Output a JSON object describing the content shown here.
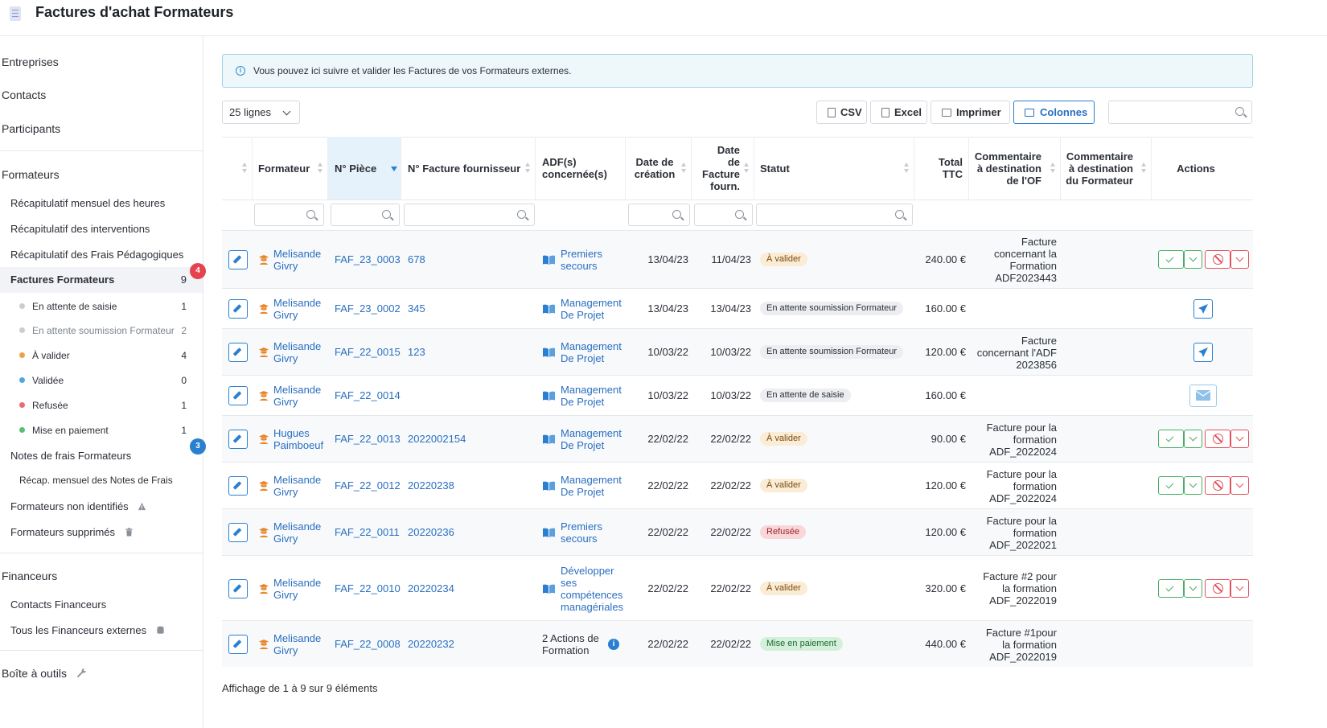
{
  "header": {
    "title": "Factures d'achat Formateurs"
  },
  "sidebar": {
    "top_items": [
      "Entreprises",
      "Contacts",
      "Participants"
    ],
    "formateurs": {
      "title": "Formateurs",
      "items": [
        "Récapitulatif mensuel des heures",
        "Récapitulatif des interventions",
        "Récapitulatif des Frais Pédagogiques"
      ],
      "active": {
        "label": "Factures Formateurs",
        "count": "9",
        "badge": "4"
      },
      "statuses": [
        {
          "label": "En attente de saisie",
          "count": "1",
          "color": "#c9cdd3"
        },
        {
          "label": "En attente soumission Formateur",
          "count": "2",
          "color": "#c9cdd3"
        },
        {
          "label": "À valider",
          "count": "4",
          "color": "#f0a04b"
        },
        {
          "label": "Validée",
          "count": "0",
          "color": "#4ea8de"
        },
        {
          "label": "Refusée",
          "count": "1",
          "color": "#ec6b73"
        },
        {
          "label": "Mise en paiement",
          "count": "1",
          "color": "#55c273"
        }
      ],
      "notes": {
        "label": "Notes de frais Formateurs",
        "badge": "3"
      },
      "recap_notes": "Récap. mensuel des Notes de Frais",
      "non_identifies": "Formateurs non identifiés",
      "supprimes": "Formateurs supprimés"
    },
    "financeurs": {
      "title": "Financeurs",
      "items": [
        "Contacts Financeurs",
        "Tous les Financeurs externes"
      ]
    },
    "outils": "Boîte à outils"
  },
  "info_banner": "Vous pouvez ici suivre et valider les Factures de vos Formateurs externes.",
  "toolbar": {
    "lines": "25 lignes",
    "csv": "CSV",
    "excel": "Excel",
    "print": "Imprimer",
    "columns": "Colonnes",
    "search_placeholder": ""
  },
  "table": {
    "headers": {
      "formateur": "Formateur",
      "piece": "N° Pièce",
      "facture": "N° Facture fournisseur",
      "adf": [
        "ADF(s)",
        "concernée(s)"
      ],
      "creation": [
        "Date de",
        "création"
      ],
      "date_facture": [
        "Date",
        "de",
        "Facture",
        "fourn."
      ],
      "statut": "Statut",
      "total": [
        "Total",
        "TTC"
      ],
      "comment_of": [
        "Commentaire",
        "à destination",
        "de l'OF"
      ],
      "comment_form": [
        "Commentaire",
        "à destination",
        "du Formateur"
      ],
      "actions": "Actions"
    },
    "rows": [
      {
        "formateur": [
          "Melisande",
          "Givry"
        ],
        "piece": "FAF_23_0003",
        "facture": "678",
        "adf": [
          "Premiers",
          "secours"
        ],
        "creation": "13/04/23",
        "date_facture": "11/04/23",
        "statut": "À valider",
        "total": "240.00 €",
        "comment": [
          "Facture",
          "concernant la",
          "Formation",
          "ADF2023443"
        ]
      },
      {
        "formateur": [
          "Melisande",
          "Givry"
        ],
        "piece": "FAF_23_0002",
        "facture": "345",
        "adf": [
          "Management",
          "De Projet"
        ],
        "creation": "13/04/23",
        "date_facture": "13/04/23",
        "statut": "En attente soumission Formateur",
        "total": "160.00 €",
        "comment": []
      },
      {
        "formateur": [
          "Melisande",
          "Givry"
        ],
        "piece": "FAF_22_0015",
        "facture": "123",
        "adf": [
          "Management",
          "De Projet"
        ],
        "creation": "10/03/22",
        "date_facture": "10/03/22",
        "statut": "En attente soumission Formateur",
        "total": "120.00 €",
        "comment": [
          "Facture",
          "concernant l'ADF",
          "2023856"
        ]
      },
      {
        "formateur": [
          "Melisande",
          "Givry"
        ],
        "piece": "FAF_22_0014",
        "facture": "",
        "adf": [
          "Management",
          "De Projet"
        ],
        "creation": "10/03/22",
        "date_facture": "10/03/22",
        "statut": "En attente de saisie",
        "total": "160.00 €",
        "comment": []
      },
      {
        "formateur": [
          "Hugues",
          "Paimboeuf"
        ],
        "piece": "FAF_22_0013",
        "facture": "2022002154",
        "adf": [
          "Management",
          "De Projet"
        ],
        "creation": "22/02/22",
        "date_facture": "22/02/22",
        "statut": "À valider",
        "total": "90.00 €",
        "comment": [
          "Facture pour la",
          "formation",
          "ADF_2022024"
        ]
      },
      {
        "formateur": [
          "Melisande",
          "Givry"
        ],
        "piece": "FAF_22_0012",
        "facture": "20220238",
        "adf": [
          "Management",
          "De Projet"
        ],
        "creation": "22/02/22",
        "date_facture": "22/02/22",
        "statut": "À valider",
        "total": "120.00 €",
        "comment": [
          "Facture pour la",
          "formation",
          "ADF_2022024"
        ]
      },
      {
        "formateur": [
          "Melisande",
          "Givry"
        ],
        "piece": "FAF_22_0011",
        "facture": "20220236",
        "adf": [
          "Premiers",
          "secours"
        ],
        "creation": "22/02/22",
        "date_facture": "22/02/22",
        "statut": "Refusée",
        "total": "120.00 €",
        "comment": [
          "Facture pour la",
          "formation",
          "ADF_2022021"
        ]
      },
      {
        "formateur": [
          "Melisande",
          "Givry"
        ],
        "piece": "FAF_22_0010",
        "facture": "20220234",
        "adf": [
          "Développer",
          "ses",
          "compétences",
          "managériales"
        ],
        "creation": "22/02/22",
        "date_facture": "22/02/22",
        "statut": "À valider",
        "total": "320.00 €",
        "comment": [
          "Facture #2 pour",
          "la formation",
          "ADF_2022019"
        ]
      },
      {
        "formateur": [
          "Melisande",
          "Givry"
        ],
        "piece": "FAF_22_0008",
        "facture": "20220232",
        "adf": [
          "2 Actions de",
          "Formation"
        ],
        "creation": "22/02/22",
        "date_facture": "22/02/22",
        "statut": "Mise en paiement",
        "total": "440.00 €",
        "comment": [
          "Facture #1pour",
          "la formation",
          "ADF_2022019"
        ]
      }
    ]
  },
  "footer": "Affichage de 1 à 9 sur 9 éléments"
}
